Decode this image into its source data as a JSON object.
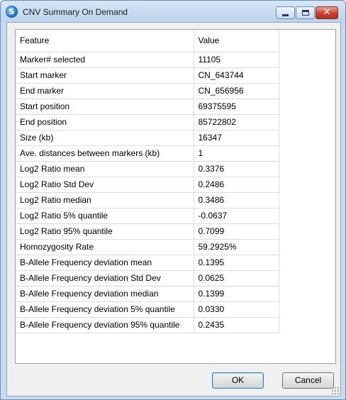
{
  "window": {
    "title": "CNV Summary On Demand",
    "close_glyph": "✕"
  },
  "icons": {
    "app": "app-logo-icon",
    "minimize": "minimize-icon",
    "maximize": "maximize-icon",
    "close": "close-icon",
    "grip": "resize-grip-icon"
  },
  "colors": {
    "close_button": "#c8402c",
    "window_frame": "#c9dcef"
  },
  "table": {
    "headers": [
      "Feature",
      "Value"
    ],
    "rows": [
      {
        "feature": "Marker# selected",
        "value": "11105"
      },
      {
        "feature": "Start marker",
        "value": "CN_643744"
      },
      {
        "feature": "End marker",
        "value": "CN_656956"
      },
      {
        "feature": "Start position",
        "value": "69375595"
      },
      {
        "feature": "End position",
        "value": "85722802"
      },
      {
        "feature": "Size (kb)",
        "value": "16347"
      },
      {
        "feature": "Ave. distances between markers (kb)",
        "value": "1"
      },
      {
        "feature": "Log2 Ratio mean",
        "value": "0.3376"
      },
      {
        "feature": "Log2 Ratio Std Dev",
        "value": "0.2486"
      },
      {
        "feature": "Log2 Ratio median",
        "value": "0.3486"
      },
      {
        "feature": "Log2 Ratio 5% quantile",
        "value": "-0.0637"
      },
      {
        "feature": "Log2 Ratio 95% quantile",
        "value": "0.7099"
      },
      {
        "feature": "Homozygosity Rate",
        "value": "59.2925%"
      },
      {
        "feature": "B-Allele Frequency deviation mean",
        "value": "0.1395"
      },
      {
        "feature": "B-Allele Frequency deviation Std Dev",
        "value": "0.0625"
      },
      {
        "feature": "B-Allele Frequency deviation median",
        "value": "0.1399"
      },
      {
        "feature": "B-Allele Frequency deviation 5% quantile",
        "value": "0.0330"
      },
      {
        "feature": "B-Allele Frequency deviation 95% quantile",
        "value": "0.2435"
      }
    ]
  },
  "buttons": {
    "ok": "OK",
    "cancel": "Cancel"
  }
}
